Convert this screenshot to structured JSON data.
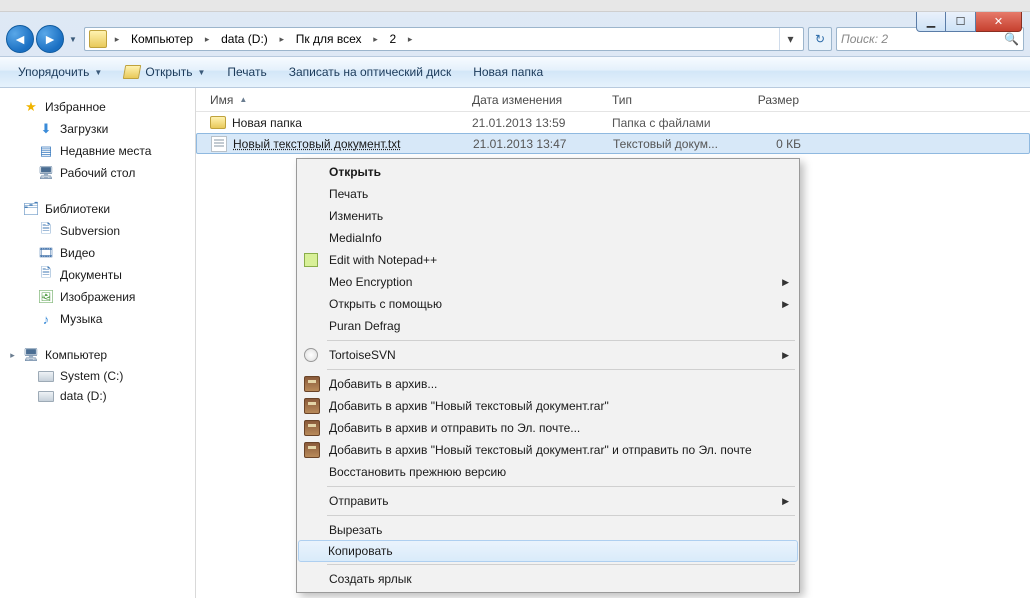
{
  "breadcrumb": {
    "segments": [
      "Компьютер",
      "data (D:)",
      "Пк для всех",
      "2"
    ]
  },
  "search": {
    "placeholder": "Поиск: 2"
  },
  "toolbar": {
    "organize": "Упорядочить",
    "open": "Открыть",
    "print": "Печать",
    "burn": "Записать на оптический диск",
    "newfolder": "Новая папка"
  },
  "sidebar": {
    "favorites": {
      "label": "Избранное",
      "items": [
        "Загрузки",
        "Недавние места",
        "Рабочий стол"
      ]
    },
    "libraries": {
      "label": "Библиотеки",
      "items": [
        "Subversion",
        "Видео",
        "Документы",
        "Изображения",
        "Музыка"
      ]
    },
    "computer": {
      "label": "Компьютер",
      "items": [
        "System (C:)",
        "data (D:)"
      ]
    }
  },
  "columns": {
    "name": "Имя",
    "date": "Дата изменения",
    "type": "Тип",
    "size": "Размер"
  },
  "rows": [
    {
      "name": "Новая папка",
      "date": "21.01.2013 13:59",
      "type": "Папка с файлами",
      "size": "",
      "kind": "folder",
      "selected": false
    },
    {
      "name": "Новый текстовый документ.txt",
      "date": "21.01.2013 13:47",
      "type": "Текстовый докум...",
      "size": "0 КБ",
      "kind": "txt",
      "selected": true
    }
  ],
  "ctx": {
    "items": [
      {
        "label": "Открыть",
        "bold": true
      },
      {
        "label": "Печать"
      },
      {
        "label": "Изменить"
      },
      {
        "label": "MediaInfo"
      },
      {
        "label": "Edit with Notepad++",
        "icon": "np"
      },
      {
        "label": "Meo Encryption",
        "submenu": true
      },
      {
        "label": "Открыть с помощью",
        "submenu": true
      },
      {
        "label": "Puran Defrag"
      },
      {
        "sep": true
      },
      {
        "label": "TortoiseSVN",
        "submenu": true,
        "icon": "svn"
      },
      {
        "sep": true
      },
      {
        "label": "Добавить в архив...",
        "icon": "rar"
      },
      {
        "label": "Добавить в архив \"Новый текстовый документ.rar\"",
        "icon": "rar"
      },
      {
        "label": "Добавить в архив и отправить по Эл. почте...",
        "icon": "rar"
      },
      {
        "label": "Добавить в архив \"Новый текстовый документ.rar\" и отправить по Эл. почте",
        "icon": "rar"
      },
      {
        "label": "Восстановить прежнюю версию"
      },
      {
        "sep": true
      },
      {
        "label": "Отправить",
        "submenu": true
      },
      {
        "sep": true
      },
      {
        "label": "Вырезать"
      },
      {
        "label": "Копировать",
        "hover": true
      },
      {
        "sep": true
      },
      {
        "label": "Создать ярлык"
      }
    ]
  }
}
